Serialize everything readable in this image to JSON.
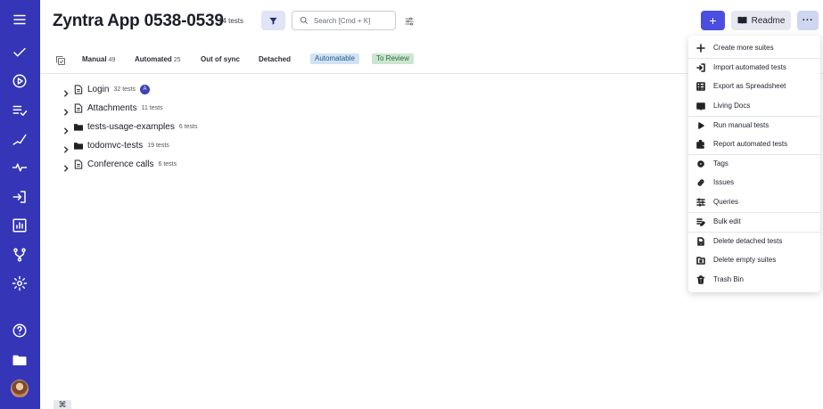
{
  "header": {
    "title": "Zyntra App 0538-0539",
    "test_count": "74 tests",
    "search_placeholder": "Search [Cmd + K]",
    "plus_label": "+",
    "readme_label": "Readme",
    "more_label": "···"
  },
  "tabs": {
    "manual_label": "Manual",
    "manual_count": "49",
    "automated_label": "Automated",
    "automated_count": "25",
    "out_of_sync_label": "Out of sync",
    "detached_label": "Detached",
    "automatable_label": "Automatable",
    "to_review_label": "To Review"
  },
  "tree": [
    {
      "name": "Login",
      "count": "32 tests",
      "type": "file",
      "badge": "A"
    },
    {
      "name": "Attachments",
      "count": "11 tests",
      "type": "file"
    },
    {
      "name": "tests-usage-examples",
      "count": "6 tests",
      "type": "folder"
    },
    {
      "name": "todomvc-tests",
      "count": "19 tests",
      "type": "folder"
    },
    {
      "name": "Conference calls",
      "count": "6 tests",
      "type": "file"
    }
  ],
  "menu": {
    "items": [
      {
        "label": "Create more suites",
        "icon": "plus-icon"
      },
      {
        "label": "Import automated tests",
        "icon": "import-icon"
      },
      {
        "label": "Export as Spreadsheet",
        "icon": "table-icon"
      },
      {
        "label": "Living Docs",
        "icon": "book-icon"
      },
      {
        "label": "Run manual tests",
        "icon": "play-icon"
      },
      {
        "label": "Report automated tests",
        "icon": "puzzle-icon"
      },
      {
        "label": "Tags",
        "icon": "at-icon"
      },
      {
        "label": "Issues",
        "icon": "link-icon"
      },
      {
        "label": "Queries",
        "icon": "sliders-icon"
      },
      {
        "label": "Bulk edit",
        "icon": "edit-list-icon"
      },
      {
        "label": "Delete detached tests",
        "icon": "delete-file-icon"
      },
      {
        "label": "Delete empty suites",
        "icon": "delete-folder-icon"
      },
      {
        "label": "Trash Bin",
        "icon": "trash-icon"
      }
    ]
  },
  "footer": {
    "cmd_key": "⌘"
  },
  "colors": {
    "sidebar": "#3535b8",
    "primary": "#4b4ee0",
    "automatable_tag": "#cfe3f5",
    "review_tag": "#cbe6d1"
  }
}
